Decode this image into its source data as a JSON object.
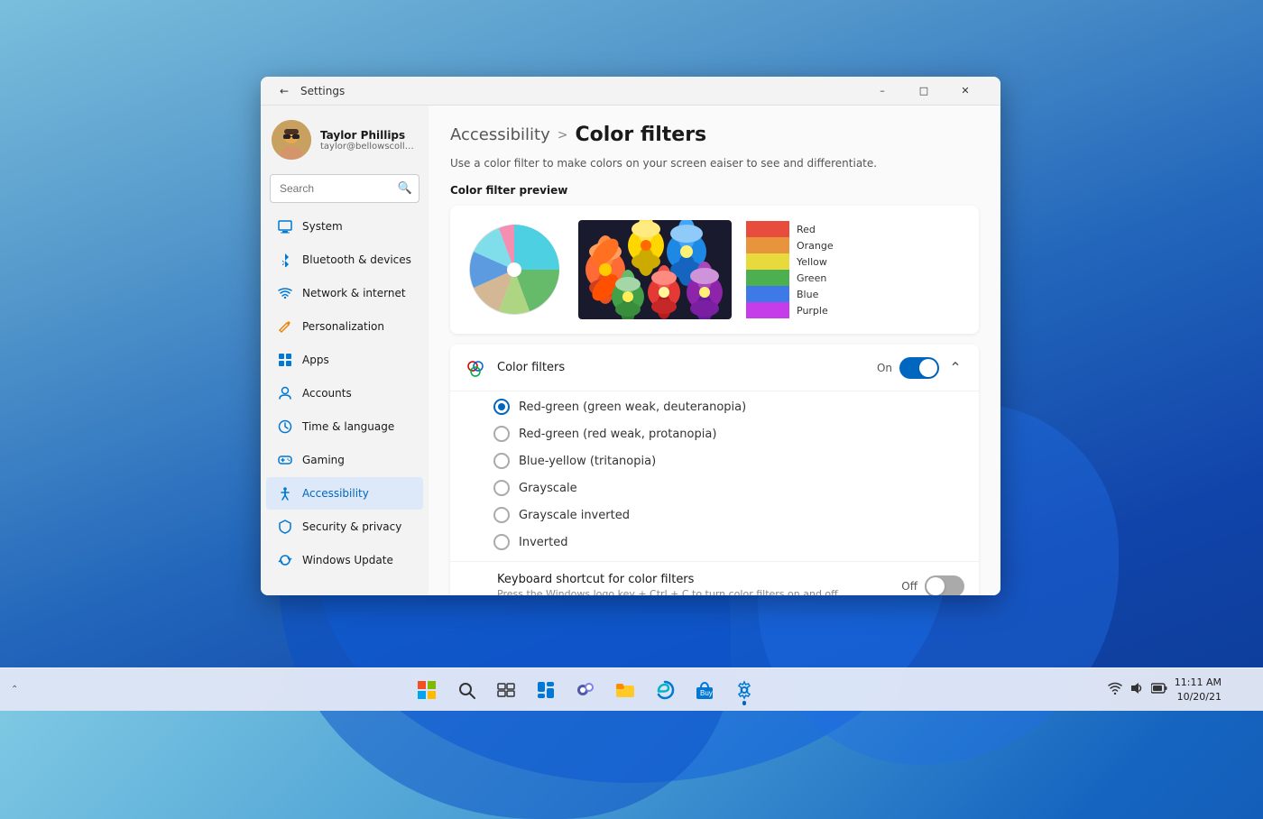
{
  "window": {
    "title": "Settings",
    "minimize_label": "–",
    "maximize_label": "□",
    "close_label": "✕"
  },
  "user": {
    "name": "Taylor Phillips",
    "email": "taylor@bellowscollege.com"
  },
  "search": {
    "placeholder": "Search"
  },
  "nav": {
    "items": [
      {
        "id": "system",
        "label": "System",
        "icon": "💻",
        "active": false
      },
      {
        "id": "bluetooth",
        "label": "Bluetooth & devices",
        "icon": "🔵",
        "active": false
      },
      {
        "id": "network",
        "label": "Network & internet",
        "icon": "🌐",
        "active": false
      },
      {
        "id": "personalization",
        "label": "Personalization",
        "icon": "✏️",
        "active": false
      },
      {
        "id": "apps",
        "label": "Apps",
        "icon": "📦",
        "active": false
      },
      {
        "id": "accounts",
        "label": "Accounts",
        "icon": "👤",
        "active": false
      },
      {
        "id": "time",
        "label": "Time & language",
        "icon": "🕐",
        "active": false
      },
      {
        "id": "gaming",
        "label": "Gaming",
        "icon": "🎮",
        "active": false
      },
      {
        "id": "accessibility",
        "label": "Accessibility",
        "icon": "♿",
        "active": true
      },
      {
        "id": "security",
        "label": "Security & privacy",
        "icon": "🛡️",
        "active": false
      },
      {
        "id": "windows-update",
        "label": "Windows Update",
        "icon": "🔄",
        "active": false
      }
    ]
  },
  "breadcrumb": {
    "parent": "Accessibility",
    "separator": ">",
    "current": "Color filters"
  },
  "page": {
    "description": "Use a color filter to make colors on your screen eaiser to see and differentiate."
  },
  "preview": {
    "label": "Color filter preview"
  },
  "color_swatches": {
    "colors": [
      {
        "color": "#e84c3d",
        "label": "Red"
      },
      {
        "color": "#e8943d",
        "label": "Orange"
      },
      {
        "color": "#e8d93d",
        "label": "Yellow"
      },
      {
        "color": "#4caf50",
        "label": "Green"
      },
      {
        "color": "#3d7ae8",
        "label": "Blue"
      },
      {
        "color": "#c53de8",
        "label": "Purple"
      }
    ]
  },
  "color_filters_section": {
    "icon": "🎨",
    "title": "Color filters",
    "status": "On",
    "toggle_on": true,
    "options": [
      {
        "id": "deuteranopia",
        "label": "Red-green (green weak, deuteranopia)",
        "selected": true
      },
      {
        "id": "protanopia",
        "label": "Red-green (red weak, protanopia)",
        "selected": false
      },
      {
        "id": "tritanopia",
        "label": "Blue-yellow (tritanopia)",
        "selected": false
      },
      {
        "id": "grayscale",
        "label": "Grayscale",
        "selected": false
      },
      {
        "id": "grayscale-inverted",
        "label": "Grayscale inverted",
        "selected": false
      },
      {
        "id": "inverted",
        "label": "Inverted",
        "selected": false
      }
    ]
  },
  "keyboard_shortcut_section": {
    "title": "Keyboard shortcut for color filters",
    "status": "Off",
    "toggle_on": false
  },
  "taskbar": {
    "start_icon": "⊞",
    "search_icon": "🔍",
    "task_view_icon": "⧉",
    "widgets_icon": "▦",
    "chat_icon": "💬",
    "explorer_icon": "📁",
    "edge_icon": "🌐",
    "store_icon": "🛒",
    "settings_icon": "⚙️",
    "clock": {
      "time": "11:11 AM",
      "date": "10/20/21"
    }
  }
}
